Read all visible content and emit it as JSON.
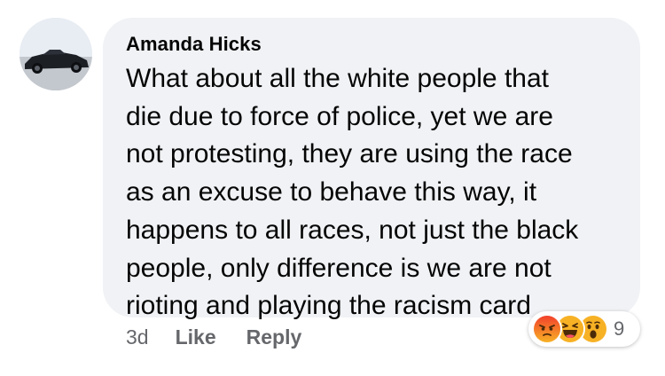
{
  "comment": {
    "author": "Amanda Hicks",
    "lines": [
      "What about all the white people that",
      "die due to force of police, yet we are",
      "not protesting, they are using the race",
      "as an excuse to behave this way, it",
      "happens to all races, not just the black",
      "people, only difference is we are not",
      "rioting and playing the racism card"
    ],
    "timestamp": "3d",
    "like_label": "Like",
    "reply_label": "Reply"
  },
  "reactions": {
    "icons": [
      "angry-icon",
      "haha-icon",
      "wow-icon"
    ],
    "count": "9"
  },
  "colors": {
    "bubble_bg": "#f0f2f5",
    "text": "#050505",
    "secondary_text": "#65676b",
    "angry": "#e9710f",
    "yellow": "#f7b125"
  }
}
